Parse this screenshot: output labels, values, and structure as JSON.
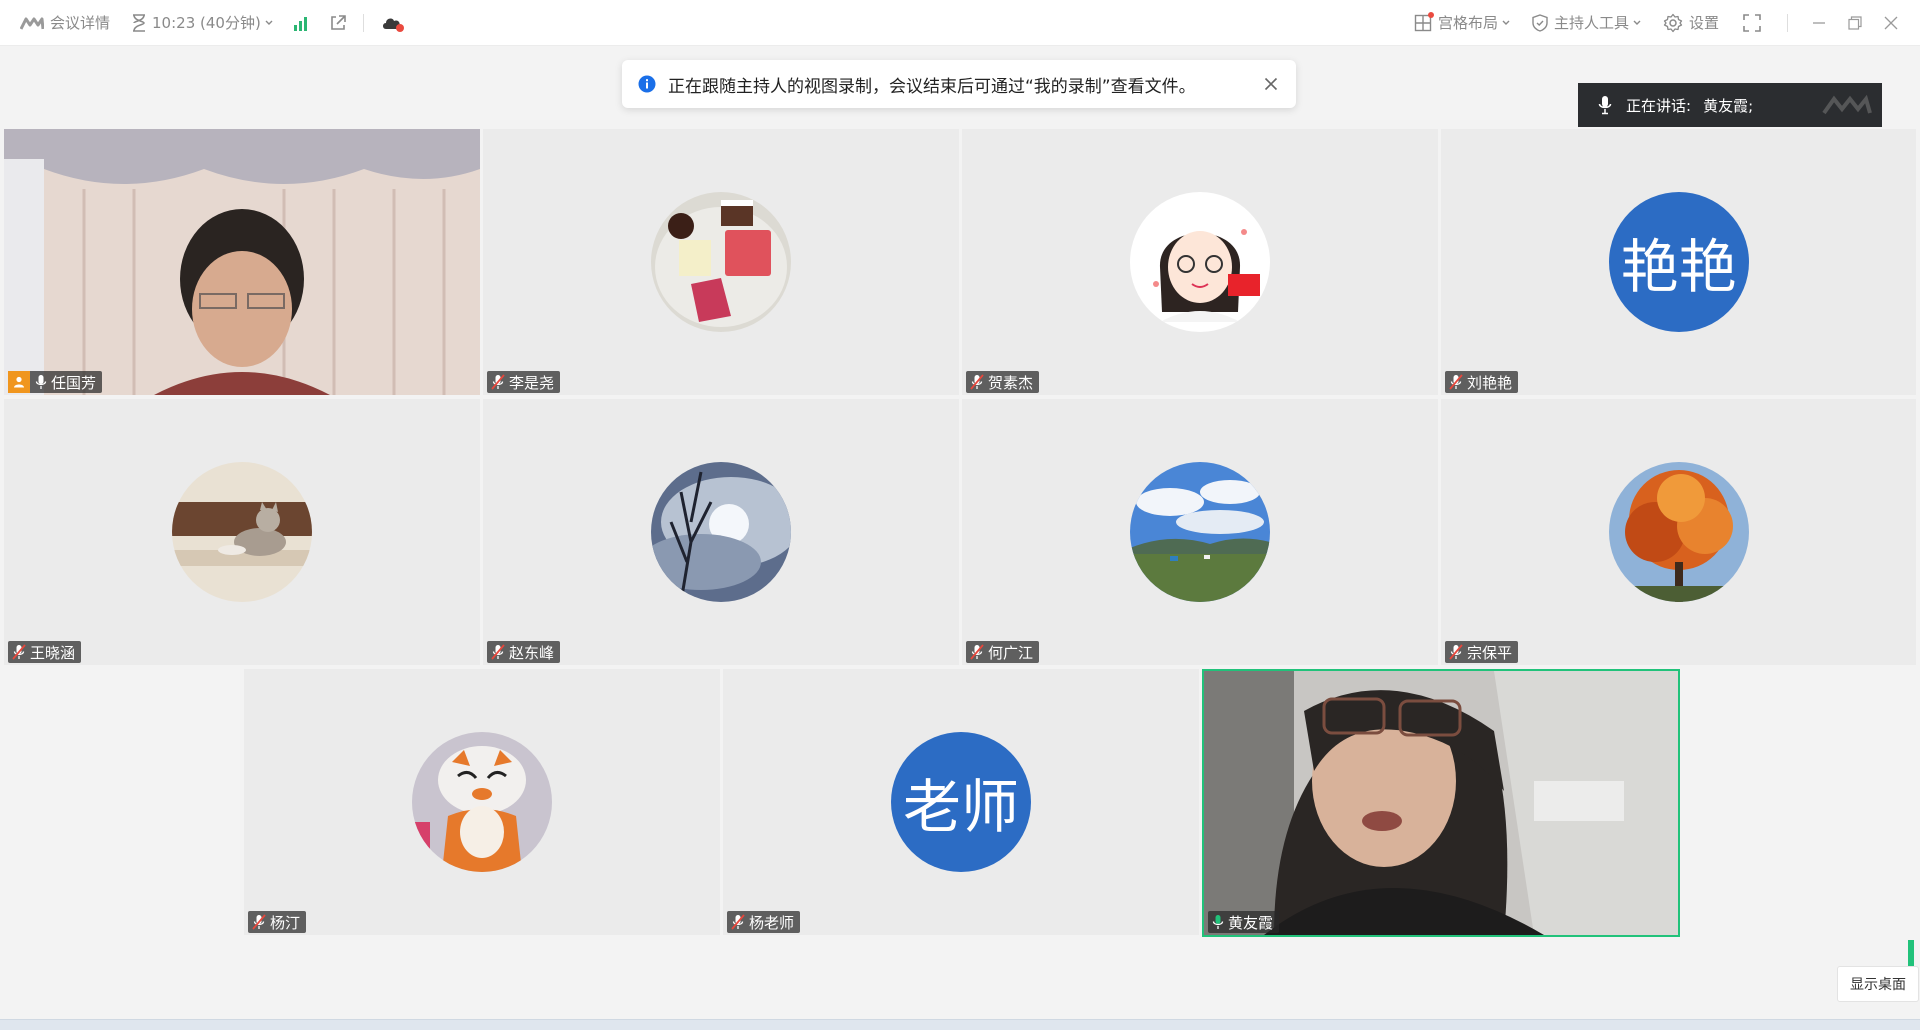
{
  "topbar": {
    "meeting_details": "会议详情",
    "timer": "10:23 (40分钟)",
    "layout": "宫格布局",
    "host_tools": "主持人工具",
    "settings": "设置"
  },
  "notice": {
    "text": "正在跟随主持人的视图录制，会议结束后可通过“我的录制”查看文件。"
  },
  "speaking": {
    "label": "正在讲话:",
    "name": "黄友霞;"
  },
  "participants": [
    {
      "name": "任国芳",
      "kind": "video",
      "host": true,
      "muted": false
    },
    {
      "name": "李是尧",
      "kind": "photo",
      "icon": "cakes-avatar",
      "muted": true
    },
    {
      "name": "贺素杰",
      "kind": "photo",
      "icon": "cartoon-girl-avatar",
      "muted": true
    },
    {
      "name": "刘艳艳",
      "kind": "text",
      "avatar_text": "艳艳",
      "muted": true
    },
    {
      "name": "王晓涵",
      "kind": "photo",
      "icon": "cat-avatar",
      "muted": true
    },
    {
      "name": "赵东峰",
      "kind": "photo",
      "icon": "sky-avatar",
      "muted": true
    },
    {
      "name": "何广江",
      "kind": "photo",
      "icon": "landscape-avatar",
      "muted": true
    },
    {
      "name": "宗保平",
      "kind": "photo",
      "icon": "autumn-tree-avatar",
      "muted": true
    },
    {
      "name": "杨汀",
      "kind": "photo",
      "icon": "tiger-toy-avatar",
      "muted": true
    },
    {
      "name": "杨老师",
      "kind": "text",
      "avatar_text": "老师",
      "muted": true
    },
    {
      "name": "黄友霞",
      "kind": "video",
      "speaking": true,
      "muted": false
    }
  ],
  "show_desktop": "显示桌面",
  "colors": {
    "avatar_blue": "#2c6cc4",
    "speaking_border": "#21c27a",
    "host_badge": "#f0961e",
    "info_blue": "#1a6fe8"
  }
}
